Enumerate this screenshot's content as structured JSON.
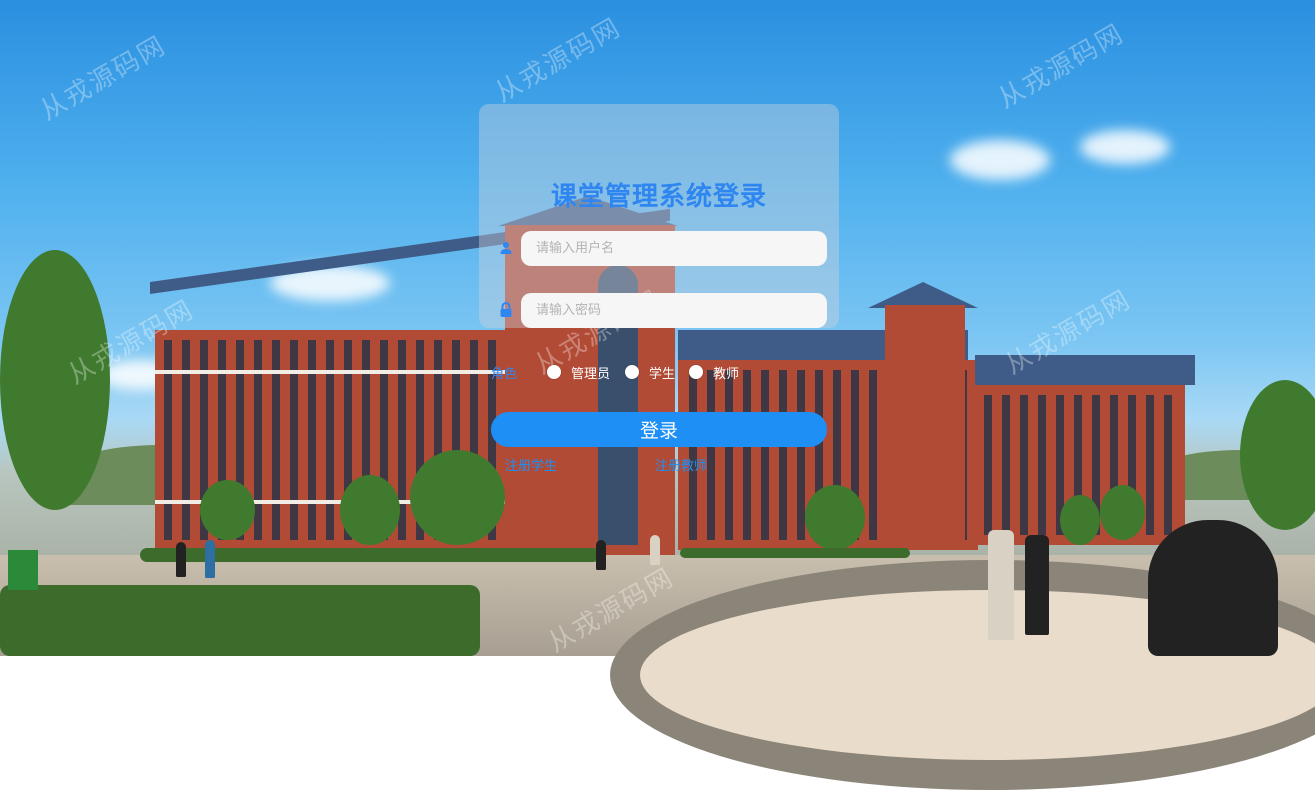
{
  "watermark": "从戎源码网",
  "login": {
    "title": "课堂管理系统登录",
    "username_placeholder": "请输入用户名",
    "password_placeholder": "请输入密码",
    "role_label": "角色",
    "roles": [
      "管理员",
      "学生",
      "教师"
    ],
    "submit_label": "登录",
    "register_student": "注册学生",
    "register_teacher": "注册教师"
  },
  "icons": {
    "username": "user-icon",
    "password": "lock-icon"
  },
  "colors": {
    "accent": "#1e8ff5",
    "title": "#2f86f0",
    "input_bg": "#f6f6f6"
  }
}
